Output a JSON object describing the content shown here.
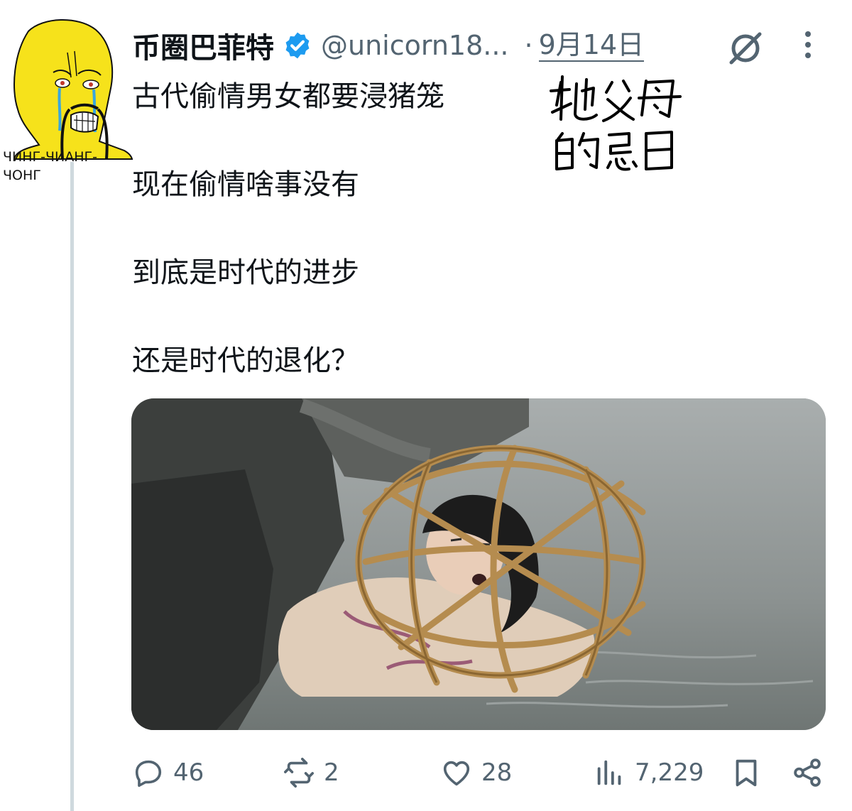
{
  "tweet": {
    "display_name": "币圈巴菲特",
    "handle": "@unicorn18...",
    "separator": "·",
    "date": "9月14日",
    "text_lines": [
      "古代偷情男女都要浸猪笼",
      "现在偷情啥事没有",
      "到底是时代的进步",
      "还是时代的退化？"
    ]
  },
  "avatar_caption_lines": [
    "ЧИНГ-ЧИАНГ-",
    "ЧОНГ"
  ],
  "handwritten_note": "牠父母的忌日",
  "media": {
    "description_icon": "photo-image"
  },
  "actions": {
    "replies": "46",
    "retweets": "2",
    "likes": "28",
    "views": "7,229"
  },
  "colors": {
    "text": "#0f1419",
    "secondary": "#536471",
    "verified": "#1d9bf0",
    "thread_line": "#cfd9de"
  },
  "icons": [
    "verified-badge-icon",
    "grok-icon",
    "more-icon",
    "reply-icon",
    "retweet-icon",
    "like-icon",
    "views-icon",
    "bookmark-icon",
    "share-icon"
  ]
}
